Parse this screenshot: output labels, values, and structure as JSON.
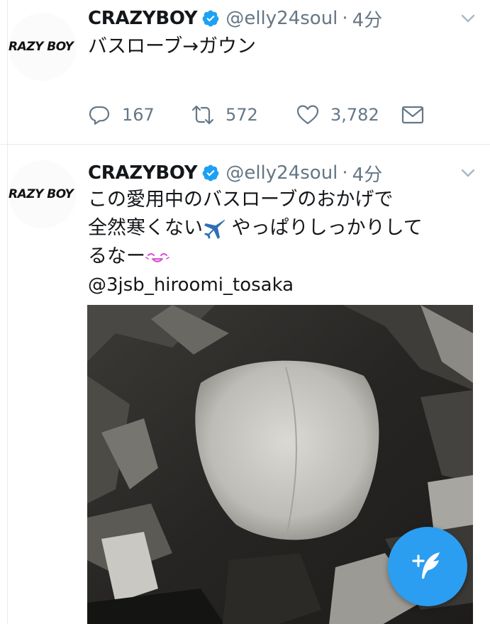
{
  "tweets": [
    {
      "author_name": "CRAZYBOY",
      "author_handle": "@elly24soul",
      "separator": "·",
      "time": "4分",
      "avatar_text": "RAZY BOY",
      "text_lines": [
        "バスローブ→ガウン"
      ],
      "reply_count": "167",
      "retweet_count": "572",
      "like_count": "3,782"
    },
    {
      "author_name": "CRAZYBOY",
      "author_handle": "@elly24soul",
      "separator": "·",
      "time": "4分",
      "avatar_text": "RAZY BOY",
      "text_line_1": "この愛用中のバスローブのおかげで",
      "text_line_2_a": "全然寒くない",
      "text_line_2_b": " やっぱりしっかりして",
      "text_line_3": "るなー",
      "mention": "@3jsb_hiroomi_tosaka"
    }
  ],
  "icons": {
    "verified": "verified-badge-icon",
    "chevron": "chevron-down-icon",
    "reply": "reply-icon",
    "retweet": "retweet-icon",
    "like": "heart-icon",
    "dm": "envelope-icon",
    "airplane": "airplane-emoji",
    "smile": "smiling-face-emoji",
    "compose": "compose-tweet-icon"
  },
  "colors": {
    "accent": "#1da1f2",
    "fab": "#2b9ef1",
    "secondary_text": "#657786",
    "primary_text": "#14171a",
    "divider": "#e6ecf0"
  }
}
